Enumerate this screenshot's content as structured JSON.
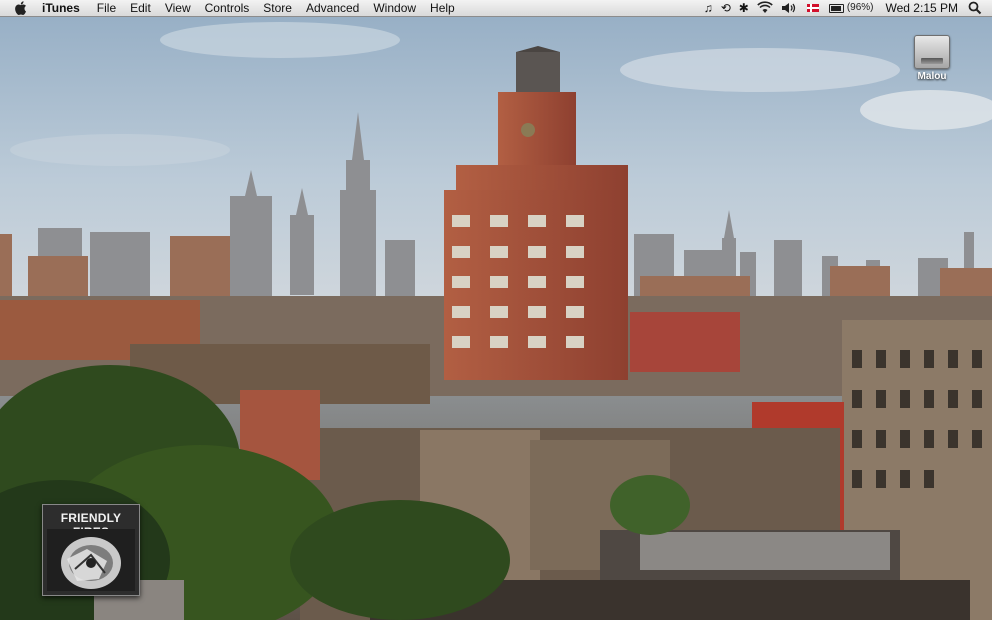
{
  "menubar": {
    "apple_icon": "apple-logo-icon",
    "app_name": "iTunes",
    "items": [
      "File",
      "Edit",
      "View",
      "Controls",
      "Store",
      "Advanced",
      "Window",
      "Help"
    ],
    "status": {
      "music_icon": "music-note-icon",
      "time_machine_icon": "time-machine-icon",
      "bluetooth_icon": "bluetooth-icon",
      "wifi_icon": "wifi-icon",
      "volume_icon": "volume-icon",
      "flag_icon": "danish-flag-icon",
      "battery_text": "(96%)",
      "battery_level": 0.96,
      "clock": "Wed 2:15 PM",
      "spotlight_icon": "spotlight-search-icon"
    }
  },
  "desktop": {
    "drive_label": "Malou",
    "wallpaper": "New York City skyline with brick buildings"
  },
  "album_widget": {
    "title": "FRIENDLY FIRES"
  },
  "colors": {
    "menubar_bg": "#e6e6e6",
    "sky": "#a9bccd",
    "brick": "#a9523a",
    "foliage": "#2f4a1e"
  }
}
